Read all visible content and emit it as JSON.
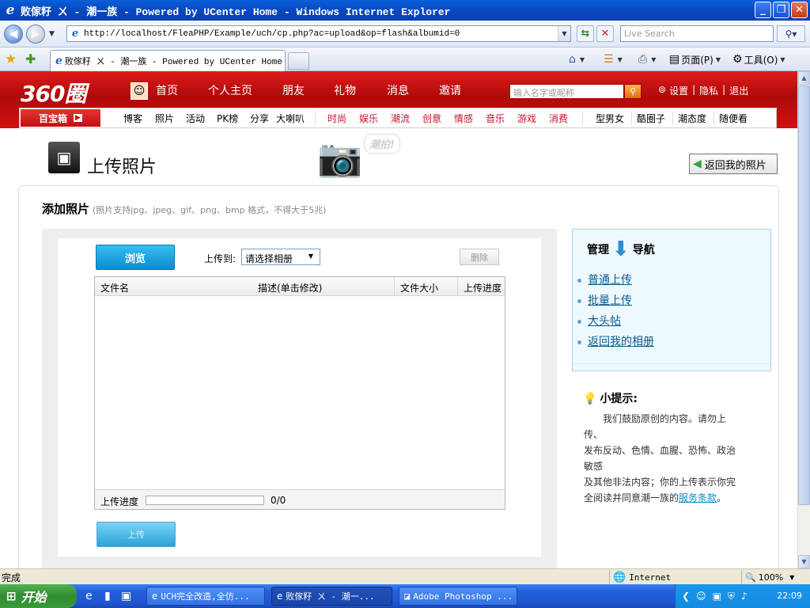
{
  "window": {
    "title": "败傢籽 ㄨ - 潮一族 - Powered by UCenter Home - Windows Internet Explorer"
  },
  "browser": {
    "url": "http://localhost/FleaPHP/Example/uch/cp.php?ac=upload&op=flash&albumid=0",
    "search_placeholder": "Live Search",
    "tab_title": "败傢籽 ㄨ - 潮一族 - Powered by UCenter Home",
    "commands": {
      "page": "页面(P)",
      "tools": "工具(O)"
    }
  },
  "site": {
    "logo": "360圈",
    "main_nav": [
      "首页",
      "个人主页",
      "朋友",
      "礼物",
      "消息",
      "邀请"
    ],
    "search_placeholder": "输入名字或昵称",
    "user_links": [
      "设置",
      "隐私",
      "退出"
    ],
    "subnav_box": "百宝箱",
    "subnav_black": [
      "博客",
      "照片",
      "活动",
      "PK榜",
      "分享",
      "大喇叭"
    ],
    "subnav_red": [
      "时尚",
      "娱乐",
      "潮流",
      "创意",
      "情感",
      "音乐",
      "游戏",
      "消费"
    ],
    "subnav_right": [
      "型男女",
      "酷圈子",
      "潮态度",
      "随便看"
    ]
  },
  "page": {
    "title": "上传照片",
    "deco_badge": "潮拍!",
    "back_button": "返回我的照片",
    "section_title": "添加照片",
    "section_hint": "(照片支持jpg、jpeg、gif、png、bmp 格式，不得大于5兆)"
  },
  "uploader": {
    "browse": "浏览",
    "upload_to_label": "上传到:",
    "album_selected": "请选择相册",
    "delete": "删除",
    "columns": [
      "文件名",
      "描述(单击修改)",
      "文件大小",
      "上传进度"
    ],
    "progress_label": "上传进度",
    "progress_fraction": 0,
    "progress_count": "0/0",
    "upload": "上传"
  },
  "nav_box": {
    "title_left": "管理",
    "title_right": "导航",
    "links": [
      "普通上传",
      "批量上传",
      "大头帖",
      "返回我的相册"
    ]
  },
  "tips": {
    "title": "小提示:",
    "line1": "我们鼓励原创的内容。请勿上",
    "line2": "传、",
    "line3": "发布反动、色情、血腥、恐怖、政治",
    "line4": "敏感",
    "line5": "及其他非法内容；你的上传表示你完",
    "line6_prefix": "全阅读并同意潮一族的",
    "terms_link": "服务条款",
    "line6_suffix": "。"
  },
  "status": {
    "text": "完成",
    "zone": "Internet",
    "zoom": "100%"
  },
  "taskbar": {
    "start": "开始",
    "tasks": [
      "UCH完全改造,全仿...",
      "败傢籽 ㄨ - 潮一...",
      "Adobe Photoshop ..."
    ],
    "clock": "22:09"
  },
  "colors": {
    "site_red": "#cf1010",
    "accent_blue": "#0e8bce",
    "link_blue": "#0b5a8e"
  }
}
